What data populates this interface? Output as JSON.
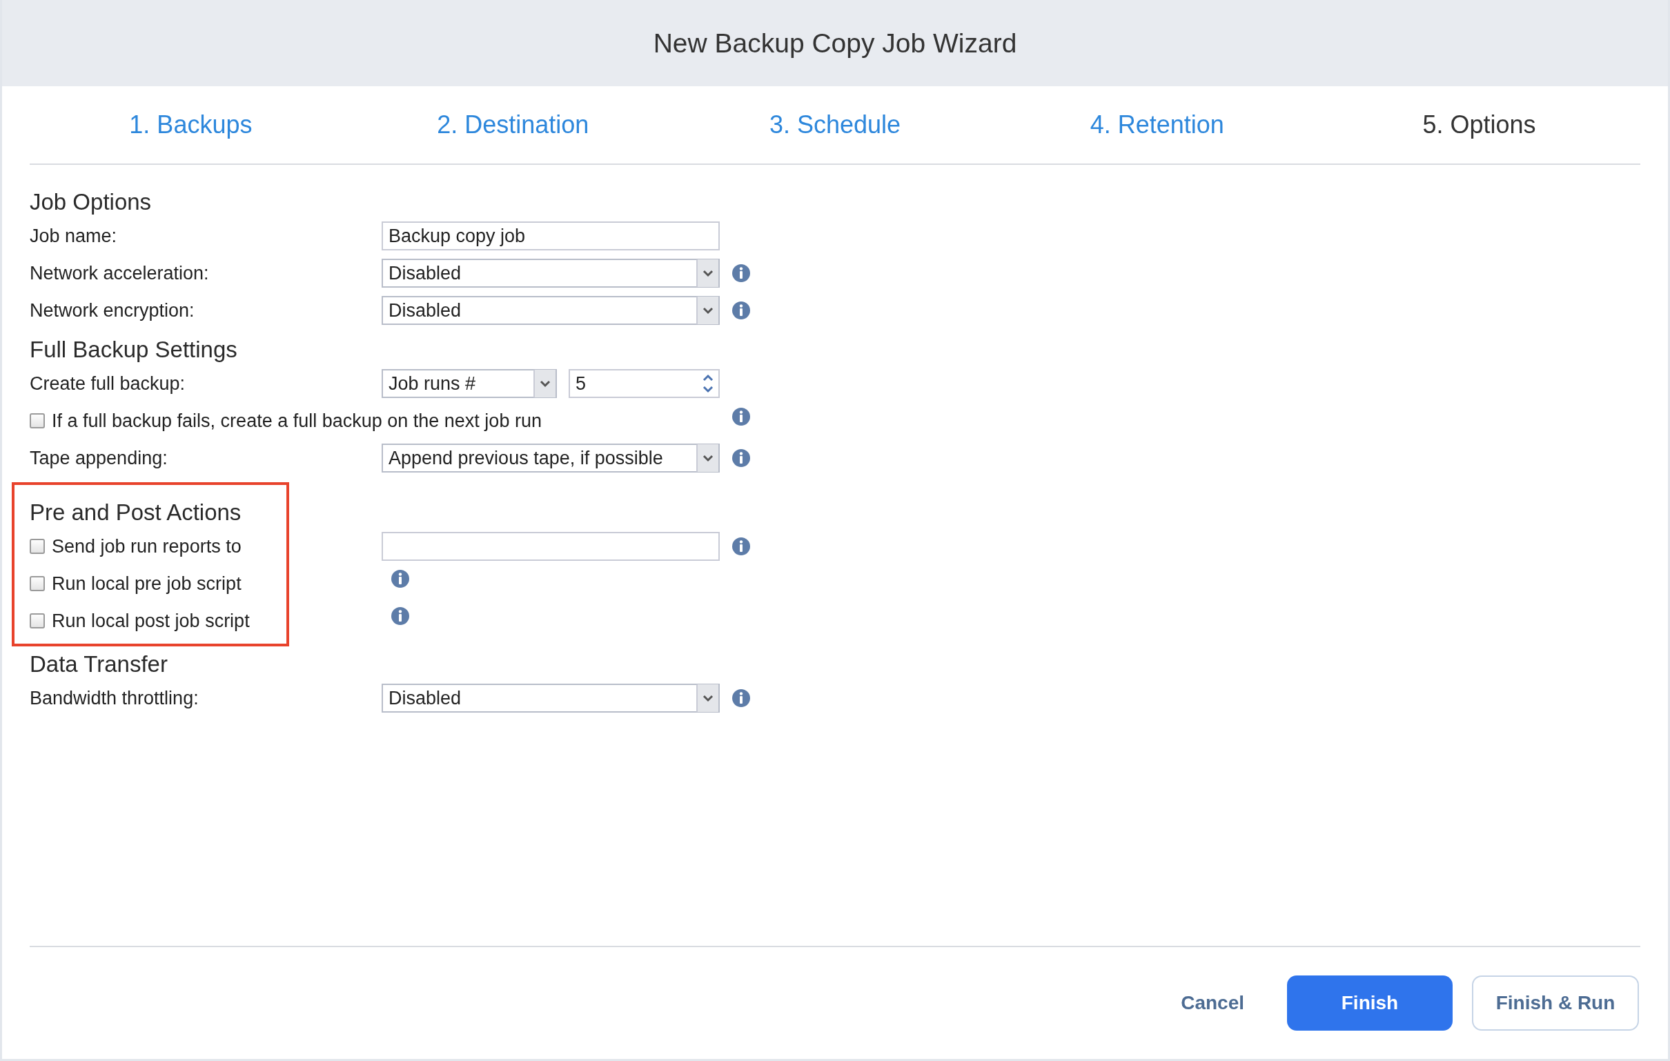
{
  "window": {
    "title": "New Backup Copy Job Wizard"
  },
  "steps": [
    {
      "label": "1. Backups",
      "selected": false
    },
    {
      "label": "2. Destination",
      "selected": false
    },
    {
      "label": "3. Schedule",
      "selected": false
    },
    {
      "label": "4. Retention",
      "selected": false
    },
    {
      "label": "5. Options",
      "selected": true
    }
  ],
  "sections": [
    {
      "title": "Job Options",
      "highlighted": false,
      "rows": [
        {
          "kind": "text",
          "label": "Job name:",
          "value": "Backup copy job",
          "info": false
        },
        {
          "kind": "select",
          "label": "Network acceleration:",
          "value": "Disabled",
          "info": true
        },
        {
          "kind": "select",
          "label": "Network encryption:",
          "value": "Disabled",
          "info": true
        }
      ]
    },
    {
      "title": "Full Backup Settings",
      "highlighted": false,
      "rows": [
        {
          "kind": "select-spinner",
          "label": "Create full backup:",
          "value": "Job runs #",
          "number": "5",
          "info": false
        },
        {
          "kind": "checkbox",
          "label": "If a full backup fails, create a full backup on the next job run",
          "checked": false,
          "info": true
        },
        {
          "kind": "select",
          "label": "Tape appending:",
          "value": "Append previous tape, if possible",
          "info": true
        }
      ]
    },
    {
      "title": "Pre and Post Actions",
      "highlighted": true,
      "rows": [
        {
          "kind": "checkbox-field",
          "label": "Send job run reports to",
          "checked": false,
          "value": "",
          "info": true
        },
        {
          "kind": "checkbox-info",
          "label": "Run local pre job script",
          "checked": false,
          "info": true
        },
        {
          "kind": "checkbox-info",
          "label": "Run local post job script",
          "checked": false,
          "info": true
        }
      ]
    },
    {
      "title": "Data Transfer",
      "highlighted": false,
      "rows": [
        {
          "kind": "select",
          "label": "Bandwidth throttling:",
          "value": "Disabled",
          "info": true
        }
      ]
    }
  ],
  "buttons": [
    {
      "label": "Cancel",
      "kind": "link"
    },
    {
      "label": "Finish",
      "kind": "primary"
    },
    {
      "label": "Finish & Run",
      "kind": "secondary"
    }
  ]
}
